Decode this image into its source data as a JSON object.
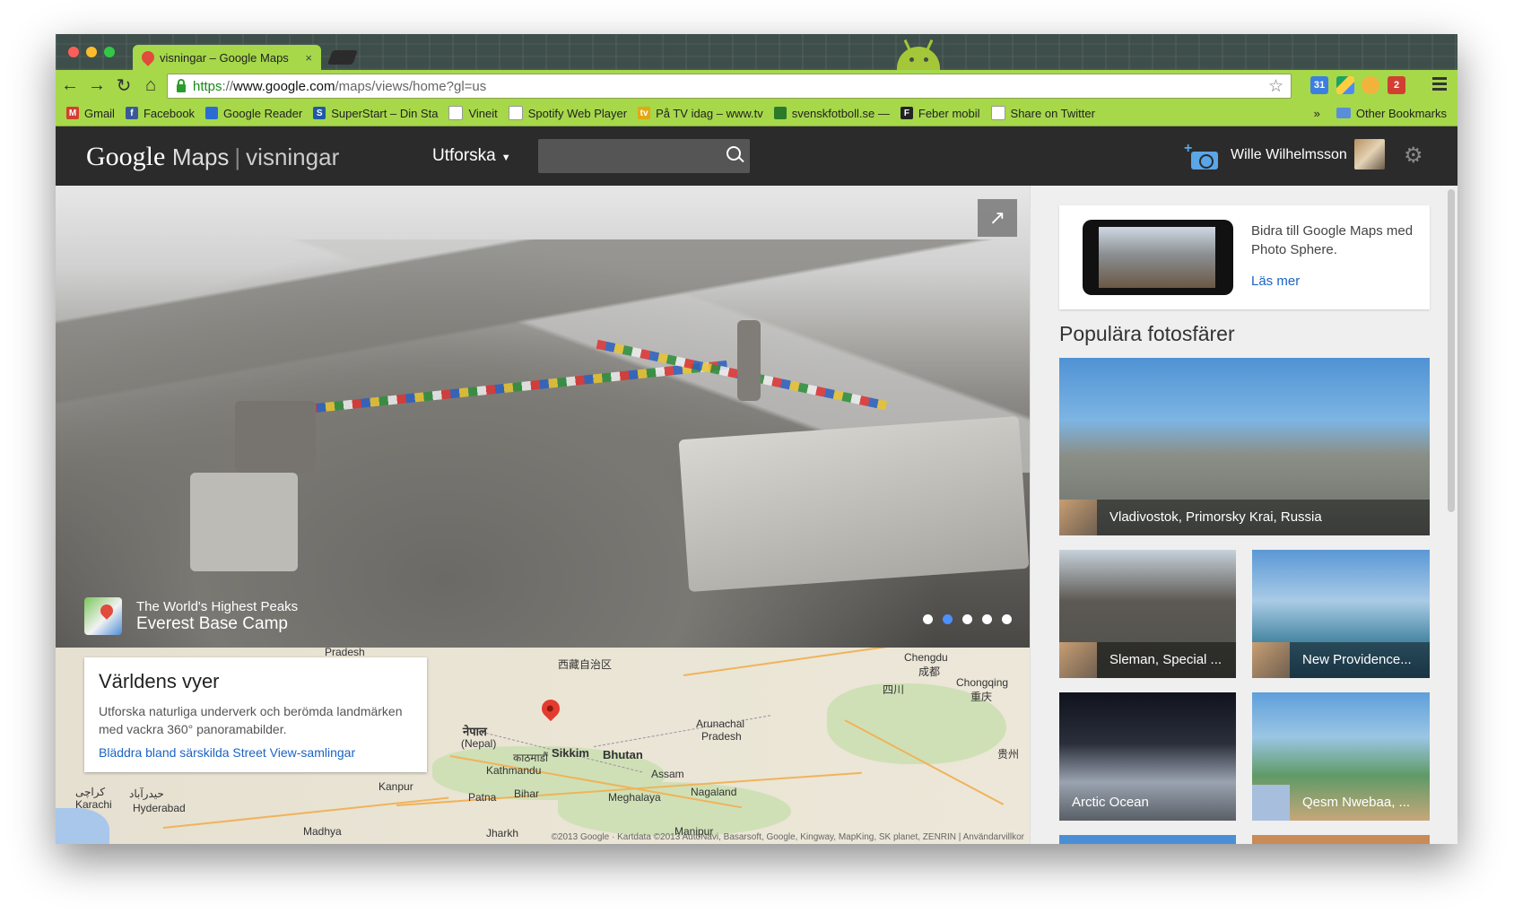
{
  "browser": {
    "tab_title": "visningar – Google Maps",
    "tab_close": "×",
    "url_scheme": "https",
    "url_sep": "://",
    "url_host": "www.google.com",
    "url_path": "/maps/views/home?gl=us",
    "calendar_badge": "31",
    "gmail_count": "2",
    "bookmarks": [
      {
        "label": "Gmail",
        "icon": "gmail-icon",
        "color": "#d23f31",
        "glyph": "M"
      },
      {
        "label": "Facebook",
        "icon": "facebook-icon",
        "color": "#3b5998",
        "glyph": "f"
      },
      {
        "label": "Google Reader",
        "icon": "rss-icon",
        "color": "#2b6cd4",
        "glyph": ""
      },
      {
        "label": "SuperStart – Din Sta",
        "icon": "superstart-icon",
        "color": "#1e5aa8",
        "glyph": "S"
      },
      {
        "label": "Vineit",
        "icon": "page-icon",
        "color": "#ffffff",
        "glyph": ""
      },
      {
        "label": "Spotify Web Player",
        "icon": "page-icon",
        "color": "#ffffff",
        "glyph": ""
      },
      {
        "label": "På TV idag – www.tv",
        "icon": "tv-icon",
        "color": "#e3a812",
        "glyph": "tv"
      },
      {
        "label": "svenskfotboll.se —",
        "icon": "football-icon",
        "color": "#2a7a2a",
        "glyph": ""
      },
      {
        "label": "Feber mobil",
        "icon": "feber-icon",
        "color": "#222222",
        "glyph": "F"
      },
      {
        "label": "Share on Twitter",
        "icon": "page-icon",
        "color": "#ffffff",
        "glyph": ""
      }
    ],
    "overflow": "»",
    "other_bookmarks": "Other Bookmarks"
  },
  "header": {
    "logo_google": "Google",
    "logo_maps": "Maps",
    "logo_sep": "|",
    "logo_views": "visningar",
    "explore": "Utforska",
    "user_name": "Wille Wilhelmsson"
  },
  "pano": {
    "subtitle": "The World's Highest Peaks",
    "title": "Everest Base Camp",
    "slides": 5,
    "active_slide": 2
  },
  "map": {
    "info_title": "Världens vyer",
    "info_text": "Utforska naturliga underverk och berömda landmärken med vackra 360° panoramabilder.",
    "info_link": "Bläddra bland särskilda Street View-samlingar",
    "labels": {
      "tibet": "西藏自治区",
      "chengdu": "Chengdu",
      "chengdu_cn": "成都",
      "sichuan": "四川",
      "chongqing": "Chongqing",
      "chongqing_cn": "重庆",
      "guizhou": "贵州",
      "pradesh_top": "Pradesh",
      "nepal": "नेपाल",
      "nepal_en": "(Nepal)",
      "kathmandu_ne": "काठमाडौं",
      "kathmandu": "Kathmandu",
      "sikkim": "Sikkim",
      "bhutan": "Bhutan",
      "arunachal": "Arunachal",
      "arunachal2": "Pradesh",
      "assam": "Assam",
      "meghalaya": "Meghalaya",
      "nagaland": "Nagaland",
      "manipur": "Manipur",
      "patna": "Patna",
      "bihar": "Bihar",
      "kanpur": "Kanpur",
      "karachi_ur": "کراچی",
      "karachi": "Karachi",
      "hyderabad_ur": "حیدرآباد",
      "hyderabad": "Hyderabad",
      "madhya": "Madhya",
      "jharkhand": "Jharkh"
    },
    "footer": "©2013 Google · Kartdata ©2013 AutoNavi, Basarsoft, Google, Kingway, MapKing, SK planet, ZENRIN  |  Användarvillkor"
  },
  "sidebar": {
    "promo_text": "Bidra till Google Maps med Photo Sphere.",
    "promo_link": "Läs mer",
    "section_title": "Populära fotosfärer",
    "cards": [
      {
        "name": "Vladivostok, Primorsky Krai, Russia"
      },
      {
        "name": "Sleman, Special ..."
      },
      {
        "name": "New Providence..."
      },
      {
        "name": "Arctic Ocean"
      },
      {
        "name": "Qesm Nwebaa, ..."
      }
    ]
  },
  "colors": {
    "chrome_green": "#a6d84a",
    "maps_bar": "#2b2b2b",
    "link_blue": "#1a63c5",
    "pin_red": "#e33b2e",
    "active_dot": "#4d90fe"
  }
}
